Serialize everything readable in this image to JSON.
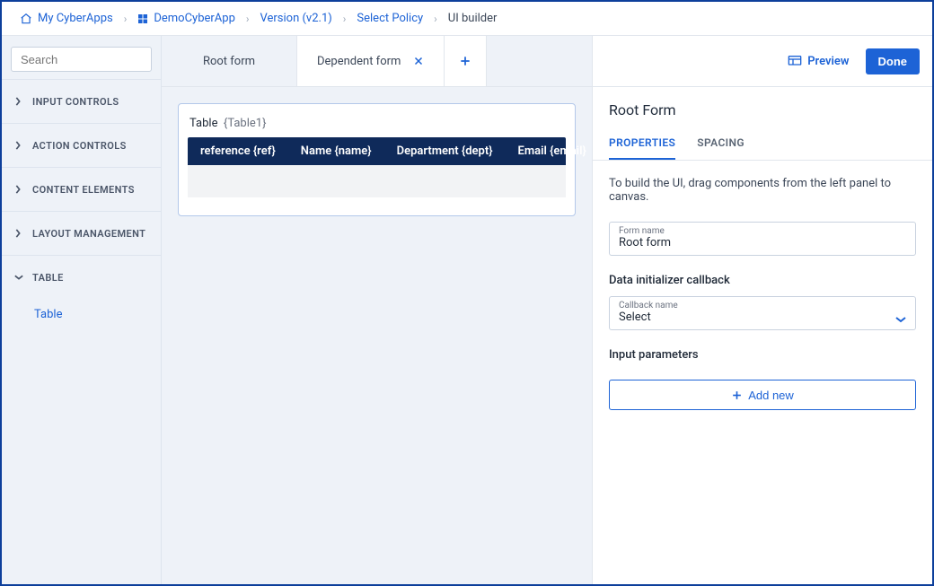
{
  "breadcrumb": {
    "items": [
      {
        "label": "My CyberApps",
        "icon": "home",
        "href": true
      },
      {
        "label": "DemoCyberApp",
        "icon": "apps",
        "href": true
      },
      {
        "label": "Version (v2.1)",
        "icon": "",
        "href": true
      },
      {
        "label": "Select Policy",
        "icon": "",
        "href": true
      },
      {
        "label": "UI builder",
        "icon": "",
        "href": false
      }
    ]
  },
  "search": {
    "placeholder": "Search"
  },
  "sidebar": {
    "groups": [
      {
        "label": "INPUT CONTROLS",
        "expanded": false
      },
      {
        "label": "ACTION CONTROLS",
        "expanded": false
      },
      {
        "label": "CONTENT ELEMENTS",
        "expanded": false
      },
      {
        "label": "LAYOUT MANAGEMENT",
        "expanded": false
      },
      {
        "label": "TABLE",
        "expanded": true,
        "items": [
          "Table"
        ]
      }
    ]
  },
  "tabs": {
    "root": "Root form",
    "dependent": "Dependent form"
  },
  "canvas": {
    "table": {
      "title": "Table",
      "var": "{Table1}",
      "columns": [
        "reference {ref}",
        "Name {name}",
        "Department {dept}",
        "Email {email}"
      ]
    }
  },
  "actions": {
    "preview": "Preview",
    "done": "Done"
  },
  "right": {
    "title": "Root Form",
    "tabs": {
      "properties": "PROPERTIES",
      "spacing": "SPACING"
    },
    "hint": "To build the UI, drag components from the left panel to canvas.",
    "form_name_label": "Form name",
    "form_name_value": "Root form",
    "callback_heading": "Data initializer callback",
    "callback_label": "Callback name",
    "callback_value": "Select",
    "params_heading": "Input parameters",
    "add_new": "Add new"
  }
}
